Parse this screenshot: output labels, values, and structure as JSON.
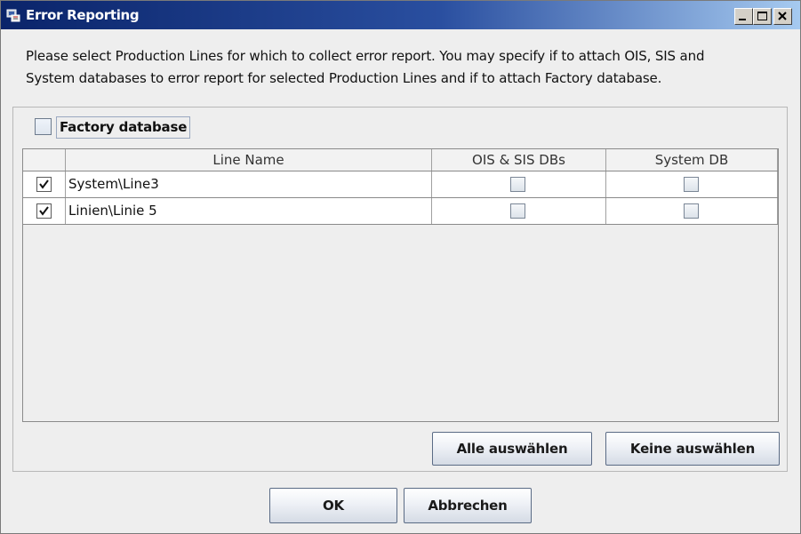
{
  "window": {
    "title": "Error Reporting",
    "icon": "error-report-app-icon",
    "controls": [
      "minimize-icon",
      "maximize-icon",
      "close-icon"
    ]
  },
  "description": {
    "line1": "Please select Production Lines for which to collect error report. You may specify if to attach OIS, SIS and",
    "line2": "System databases to error report for selected Production Lines and if to attach Factory database."
  },
  "factory_database": {
    "label": "Factory database",
    "checked": false
  },
  "table": {
    "columns": [
      "",
      "Line Name",
      "OIS & SIS DBs",
      "System DB"
    ],
    "rows": [
      {
        "selected": true,
        "name": "System\\Line3",
        "ois_sis": false,
        "system_db": false
      },
      {
        "selected": true,
        "name": "Linien\\Linie 5",
        "ois_sis": false,
        "system_db": false
      }
    ]
  },
  "buttons": {
    "select_all": "Alle auswählen",
    "select_none": "Keine auswählen",
    "ok": "OK",
    "cancel": "Abbrechen"
  },
  "colors": {
    "title_bar": "#0a246a",
    "window_bg": "#eeeeee"
  }
}
